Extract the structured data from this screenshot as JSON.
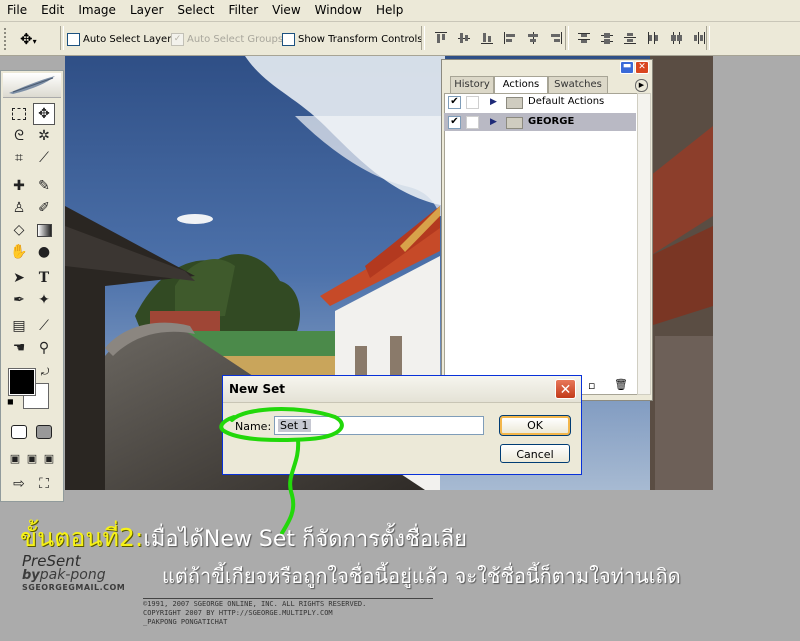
{
  "menu": {
    "items": [
      "File",
      "Edit",
      "Image",
      "Layer",
      "Select",
      "Filter",
      "View",
      "Window",
      "Help"
    ]
  },
  "options": {
    "auto_select_layer": "Auto Select Layer",
    "auto_select_groups": "Auto Select Groups",
    "show_transform": "Show Transform Controls"
  },
  "panel": {
    "tabs": [
      "History",
      "Actions",
      "Swatches"
    ],
    "rows": [
      {
        "label": "Default Actions",
        "checked": true,
        "selected": false
      },
      {
        "label": "GEORGE",
        "checked": true,
        "selected": true
      }
    ]
  },
  "dialog": {
    "title": "New Set",
    "name_label": "Name:",
    "name_value": "Set 1",
    "ok": "OK",
    "cancel": "Cancel"
  },
  "caption": {
    "step": "ขั้นตอนที่2:",
    "line1": "เมื่อได้New Set ก็จัดการตั้งชื่อเลีย",
    "line2": "แต่ถ้าขี้เกียจหรือถูกใจชื่อนี้อยู่แล้ว จะใช้ชื่อนี้ก็ตามใจท่านเถิด"
  },
  "watermark": {
    "line1": "PreSent",
    "line2": "by",
    "line3": "pak-pong",
    "line4": "SGEORGEGMAIL.COM"
  },
  "copyright": {
    "line1": "©1991, 2007 SGEORGE ONLINE, INC. ALL RIGHTS RESERVED.",
    "line2": "COPYRIGHT 2007 BY   HTTP://SGEORGE.MULTIPLY.COM",
    "line3": "_PAKPONG PONGATICHAT"
  },
  "colors": {
    "accent_green": "#22d80a",
    "caption_yellow": "#f7f216",
    "title_blue": "#0831d9",
    "close_red": "#d9461f"
  }
}
